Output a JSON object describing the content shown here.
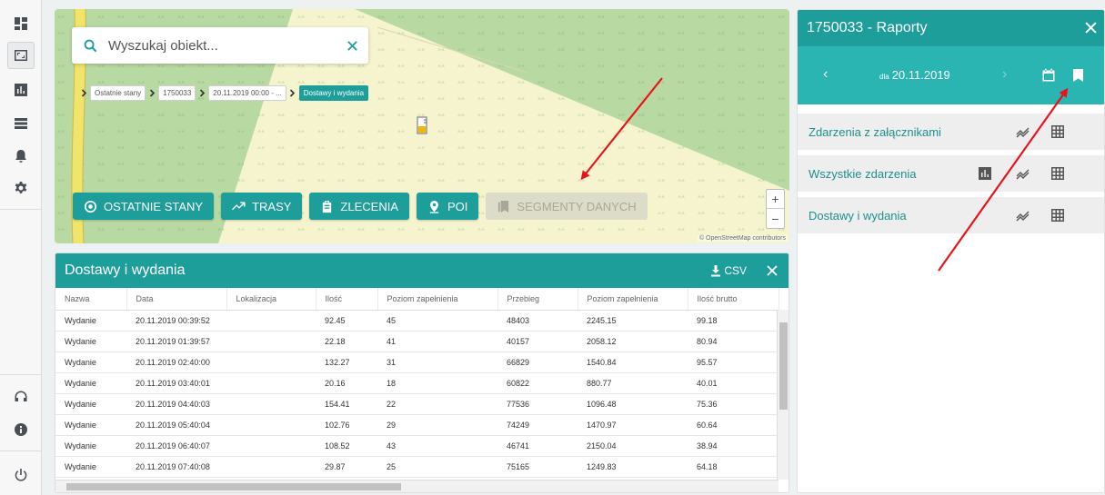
{
  "nav": {
    "items": [
      {
        "icon": "dashboard-icon"
      },
      {
        "icon": "map-icon"
      },
      {
        "icon": "bar-chart-icon"
      },
      {
        "icon": "list-icon"
      },
      {
        "icon": "bell-icon"
      },
      {
        "icon": "gear-icon"
      }
    ],
    "bottom": [
      {
        "icon": "headset-icon"
      },
      {
        "icon": "info-icon"
      },
      {
        "icon": "power-icon"
      }
    ]
  },
  "map": {
    "search_placeholder": "Wyszukaj obiekt...",
    "breadcrumbs": [
      "Ostatnie stany",
      "1750033",
      "20.11.2019 00:00 - ...",
      "Dostawy i wydania"
    ],
    "buttons": {
      "last_states": "OSTATNIE STANY",
      "routes": "TRASY",
      "orders": "ZLECENIA",
      "poi": "POI",
      "segments": "SEGMENTY DANYCH"
    },
    "zoom_in": "+",
    "zoom_out": "−",
    "attribution": "© OpenStreetMap contributors"
  },
  "table": {
    "title": "Dostawy i wydania",
    "csv_label": "CSV",
    "columns": [
      "Nazwa",
      "Data",
      "Lokalizacja",
      "Ilość",
      "Poziom zapełnienia",
      "Przebieg",
      "Poziom zapełnienia",
      "Ilość brutto"
    ],
    "rows": [
      [
        "Wydanie",
        "20.11.2019 00:39:52",
        "",
        "92.45",
        "45",
        "48403",
        "2245.15",
        "99.18"
      ],
      [
        "Wydanie",
        "20.11.2019 01:39:57",
        "",
        "22.18",
        "41",
        "40157",
        "2058.12",
        "80.94"
      ],
      [
        "Wydanie",
        "20.11.2019 02:40:00",
        "",
        "132.27",
        "31",
        "66829",
        "1540.84",
        "95.57"
      ],
      [
        "Wydanie",
        "20.11.2019 03:40:01",
        "",
        "20.16",
        "18",
        "60822",
        "880.77",
        "40.01"
      ],
      [
        "Wydanie",
        "20.11.2019 04:40:03",
        "",
        "154.41",
        "22",
        "77536",
        "1096.48",
        "75.36"
      ],
      [
        "Wydanie",
        "20.11.2019 05:40:04",
        "",
        "102.76",
        "29",
        "74249",
        "1470.97",
        "60.64"
      ],
      [
        "Wydanie",
        "20.11.2019 06:40:07",
        "",
        "108.52",
        "43",
        "46741",
        "2150.04",
        "38.94"
      ],
      [
        "Wydanie",
        "20.11.2019 07:40:08",
        "",
        "29.87",
        "25",
        "75165",
        "1249.83",
        "64.18"
      ]
    ]
  },
  "reports": {
    "title": "1750033 - Raporty",
    "date_prefix": "dla",
    "date": "20.11.2019",
    "prev": "‹",
    "next": "›",
    "items": [
      {
        "label": "Zdarzenia z załącznikami"
      },
      {
        "label": "Wszystkie zdarzenia"
      },
      {
        "label": "Dostawy i wydania"
      }
    ]
  },
  "colors": {
    "accent": "#1d9e9b",
    "accent_light": "#2bb5b2",
    "annotation": "#e8141c"
  }
}
